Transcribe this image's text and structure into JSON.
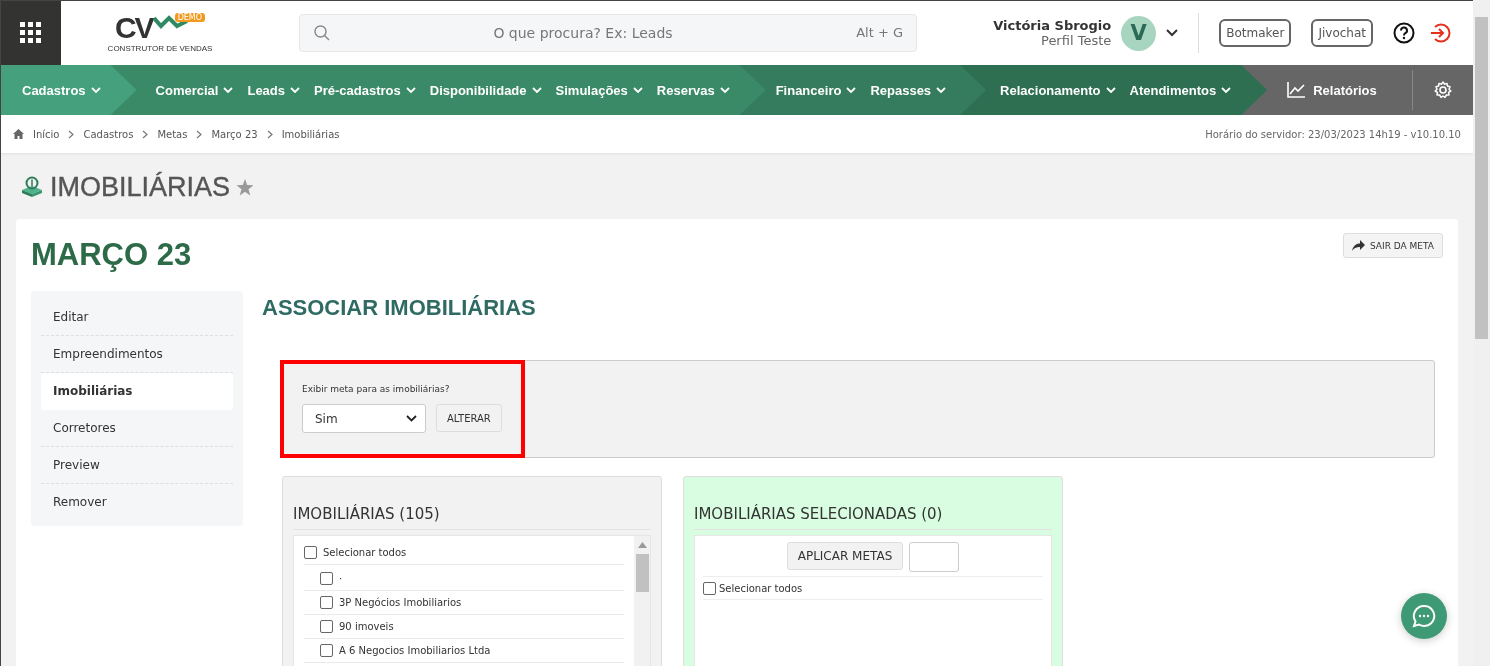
{
  "header": {
    "logo": {
      "mark": "CV",
      "badge": "DEMO",
      "tagline": "CONSTRUTOR DE VENDAS"
    },
    "search": {
      "placeholder": "O que procura? Ex: Leads",
      "shortcut": "Alt + G"
    },
    "user": {
      "name": "Victória Sbrogio",
      "profile": "Perfil Teste",
      "initial": "V"
    },
    "buttons": [
      "Botmaker",
      "Jivochat"
    ]
  },
  "nav": {
    "groups": [
      {
        "items": [
          "Cadastros"
        ]
      },
      {
        "items": [
          "Comercial",
          "Leads",
          "Pré-cadastros",
          "Disponibilidade",
          "Simulações",
          "Reservas"
        ]
      },
      {
        "items": [
          "Financeiro",
          "Repasses"
        ]
      },
      {
        "items": [
          "Relacionamento",
          "Atendimentos"
        ]
      }
    ],
    "reports": "Relatórios"
  },
  "breadcrumb": {
    "items": [
      "Início",
      "Cadastros",
      "Metas",
      "Março 23",
      "Imobiliárias"
    ],
    "server_time": "Horário do servidor: 23/03/2023 14h19 - v10.10.10"
  },
  "page_title": "IMOBILIÁRIAS",
  "card": {
    "title": "MARÇO 23",
    "exit_button": "SAIR DA META",
    "sidebar": [
      {
        "label": "Editar",
        "selected": false
      },
      {
        "label": "Empreendimentos",
        "selected": false
      },
      {
        "label": "Imobiliárias",
        "selected": true
      },
      {
        "label": "Corretores",
        "selected": false
      },
      {
        "label": "Preview",
        "selected": false
      },
      {
        "label": "Remover",
        "selected": false
      }
    ],
    "section_title": "ASSOCIAR IMOBILIÁRIAS",
    "display_form": {
      "label": "Exibir meta para as imobiliárias?",
      "value": "Sim",
      "button": "ALTERAR",
      "highlighted": true
    },
    "available": {
      "title": "IMOBILIÁRIAS (105)",
      "select_all": {
        "label": "Selecionar todos",
        "checked": false
      },
      "items": [
        {
          "label": "·",
          "checked": false
        },
        {
          "label": "3P Negócios Imobiliarios",
          "checked": false
        },
        {
          "label": "90 imoveis",
          "checked": false
        },
        {
          "label": "A 6 Negocios Imobiliarios Ltda",
          "checked": false
        }
      ]
    },
    "selected_panel": {
      "title": "IMOBILIÁRIAS SELECIONADAS (0)",
      "apply_button": "APLICAR METAS",
      "select_all": {
        "label": "Selecionar todos",
        "checked": false
      }
    }
  }
}
